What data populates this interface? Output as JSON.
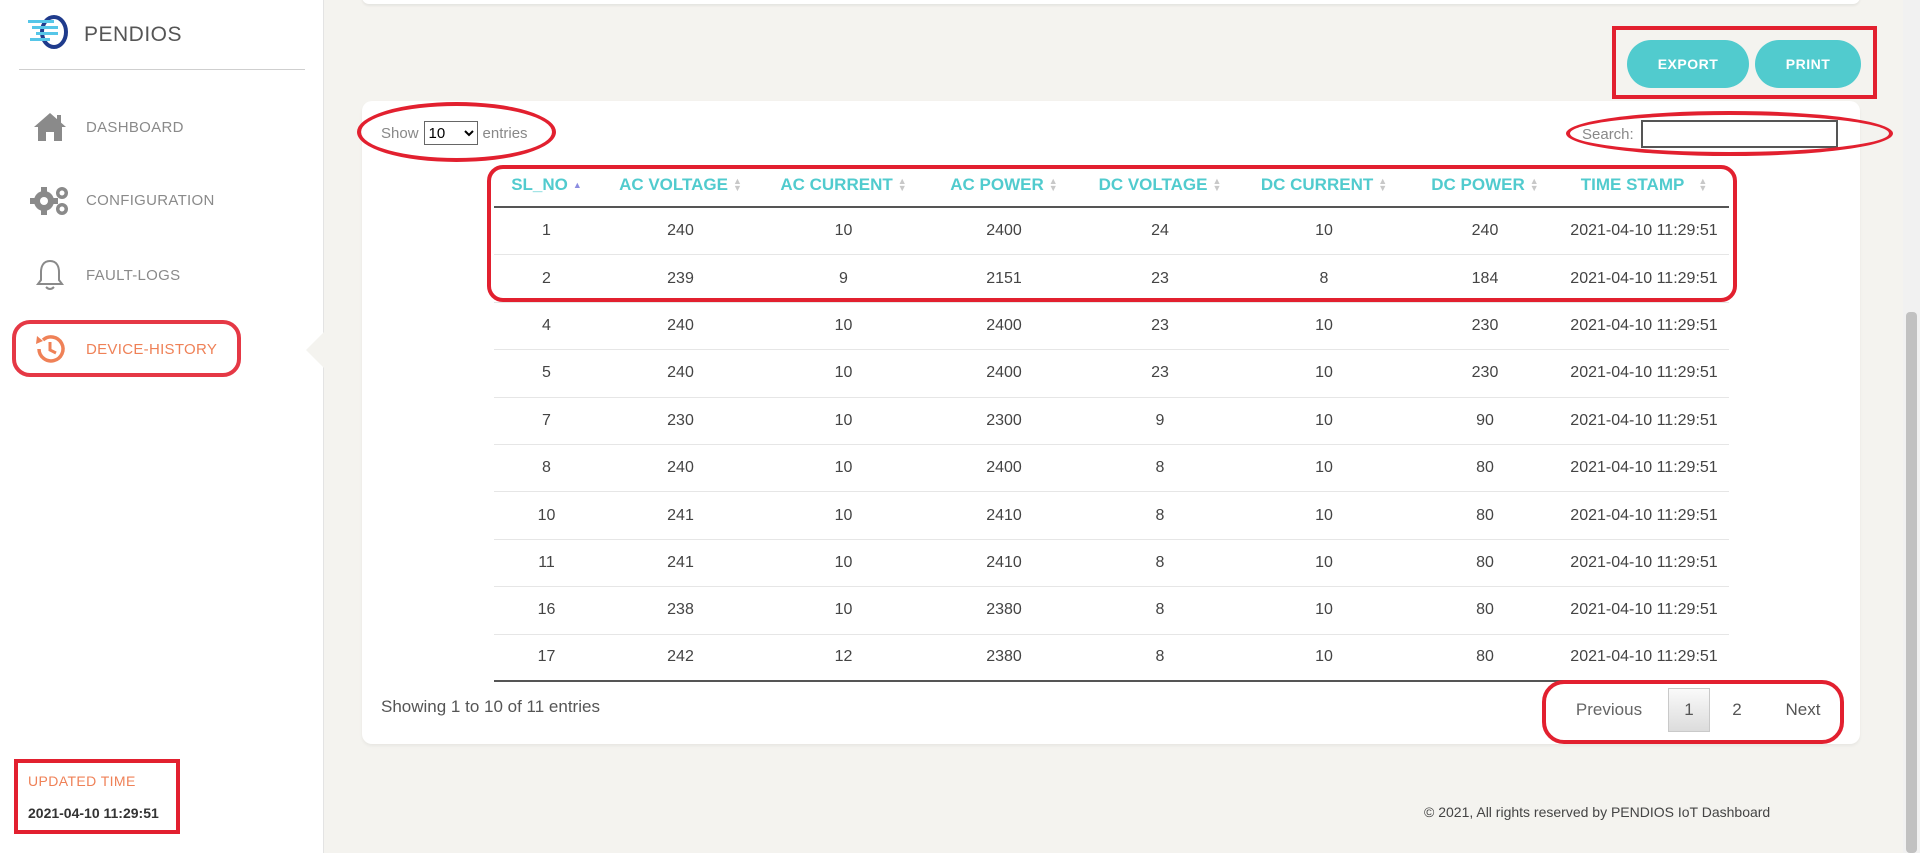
{
  "brand": {
    "name": "PENDIOS"
  },
  "sidebar": {
    "items": [
      {
        "label": "DASHBOARD",
        "icon": "home-icon"
      },
      {
        "label": "CONFIGURATION",
        "icon": "gears-icon"
      },
      {
        "label": "FAULT-LOGS",
        "icon": "bell-icon"
      },
      {
        "label": "DEVICE-HISTORY",
        "icon": "history-icon",
        "active": true
      }
    ],
    "updated_label": "UPDATED TIME",
    "updated_value": "2021-04-10 11:29:51"
  },
  "toolbar": {
    "export_label": "EXPORT",
    "print_label": "PRINT"
  },
  "table_controls": {
    "show_label": "Show",
    "entries_value": "10",
    "entries_label": "entries",
    "search_label": "Search:",
    "search_value": ""
  },
  "table": {
    "columns": [
      "SL_NO",
      "AC VOLTAGE",
      "AC CURRENT",
      "AC POWER",
      "DC VOLTAGE",
      "DC CURRENT",
      "DC POWER",
      "TIME STAMP"
    ],
    "rows": [
      [
        "1",
        "240",
        "10",
        "2400",
        "24",
        "10",
        "240",
        "2021-04-10 11:29:51"
      ],
      [
        "2",
        "239",
        "9",
        "2151",
        "23",
        "8",
        "184",
        "2021-04-10 11:29:51"
      ],
      [
        "4",
        "240",
        "10",
        "2400",
        "23",
        "10",
        "230",
        "2021-04-10 11:29:51"
      ],
      [
        "5",
        "240",
        "10",
        "2400",
        "23",
        "10",
        "230",
        "2021-04-10 11:29:51"
      ],
      [
        "7",
        "230",
        "10",
        "2300",
        "9",
        "10",
        "90",
        "2021-04-10 11:29:51"
      ],
      [
        "8",
        "240",
        "10",
        "2400",
        "8",
        "10",
        "80",
        "2021-04-10 11:29:51"
      ],
      [
        "10",
        "241",
        "10",
        "2410",
        "8",
        "10",
        "80",
        "2021-04-10 11:29:51"
      ],
      [
        "11",
        "241",
        "10",
        "2410",
        "8",
        "10",
        "80",
        "2021-04-10 11:29:51"
      ],
      [
        "16",
        "238",
        "10",
        "2380",
        "8",
        "10",
        "80",
        "2021-04-10 11:29:51"
      ],
      [
        "17",
        "242",
        "12",
        "2380",
        "8",
        "10",
        "80",
        "2021-04-10 11:29:51"
      ]
    ],
    "info": "Showing 1 to 10 of 11 entries"
  },
  "pagination": {
    "previous": "Previous",
    "pages": [
      "1",
      "2"
    ],
    "next": "Next",
    "current": "1"
  },
  "footer": {
    "text": "© 2021, All rights reserved by PENDIOS IoT Dashboard"
  },
  "colors": {
    "accent": "#51cbce",
    "active": "#ef8157",
    "annotation": "#e2202f"
  }
}
